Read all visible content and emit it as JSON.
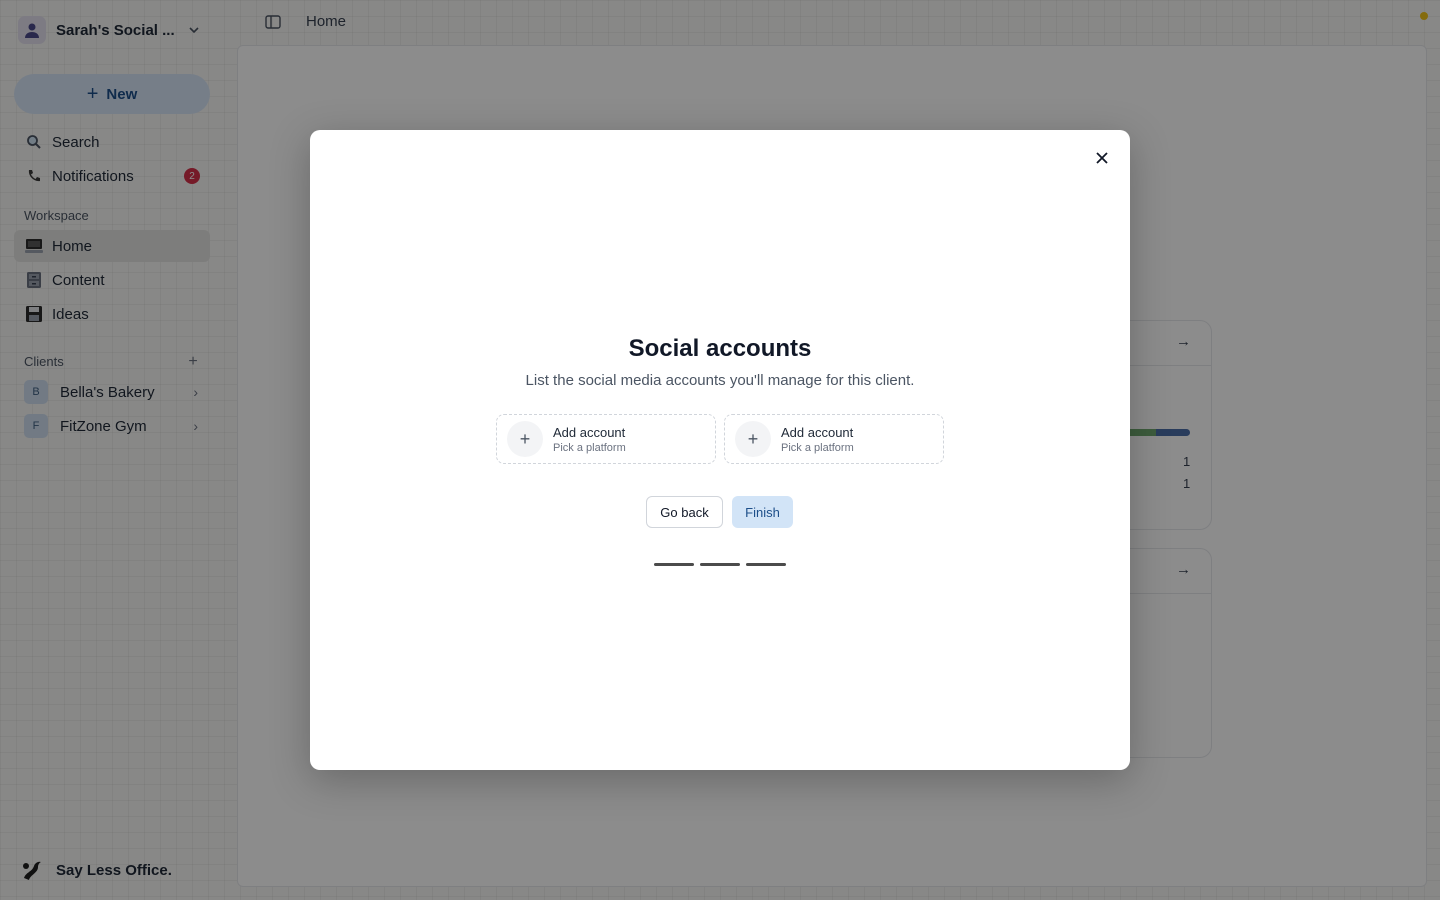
{
  "sidebar": {
    "workspace_name": "Sarah's Social ...",
    "new_label": "New",
    "search_label": "Search",
    "notifications_label": "Notifications",
    "notifications_count": "2",
    "workspace_section": "Workspace",
    "nav": [
      {
        "label": "Home",
        "icon": "computer-icon"
      },
      {
        "label": "Content",
        "icon": "file-cabinet-icon"
      },
      {
        "label": "Ideas",
        "icon": "floppy-disk-icon"
      }
    ],
    "clients_section": "Clients",
    "clients": [
      {
        "initial": "B",
        "label": "Bella's Bakery"
      },
      {
        "initial": "F",
        "label": "FitZone Gym"
      }
    ],
    "footer_brand": "Say Less Office."
  },
  "topbar": {
    "breadcrumb": "Home"
  },
  "background": {
    "counts": [
      "1",
      "1"
    ],
    "progress_share": [
      0.73,
      0.12,
      0.15
    ]
  },
  "modal": {
    "title": "Social accounts",
    "subtitle": "List the social media accounts you'll manage for this client.",
    "accounts": [
      {
        "title": "Add account",
        "subtitle": "Pick a platform"
      },
      {
        "title": "Add account",
        "subtitle": "Pick a platform"
      }
    ],
    "back_label": "Go back",
    "finish_label": "Finish",
    "steps_total": 3
  },
  "colors": {
    "accent": "#d2e4f7",
    "accent_text": "#1d4f8a",
    "badge": "#d6304a",
    "status_dot": "#f0c419"
  }
}
